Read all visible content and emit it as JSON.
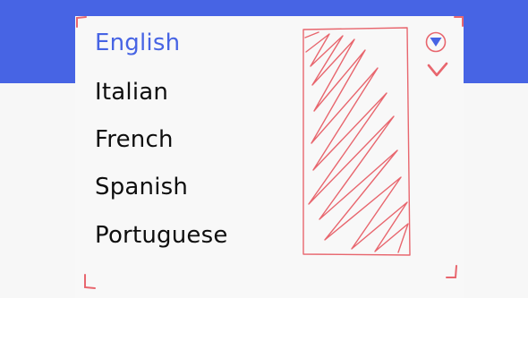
{
  "dropdown": {
    "options": [
      {
        "label": "English",
        "selected": true
      },
      {
        "label": "Italian",
        "selected": false
      },
      {
        "label": "French",
        "selected": false
      },
      {
        "label": "Spanish",
        "selected": false
      },
      {
        "label": "Portuguese",
        "selected": false
      }
    ],
    "toggle_icon": "triangle-down-icon",
    "confirm_icon": "checkmark-icon"
  },
  "colors": {
    "accent": "#4764e4",
    "annotation": "#e8666e",
    "text": "#0e0e0e",
    "panel": "#f8f8f8"
  }
}
